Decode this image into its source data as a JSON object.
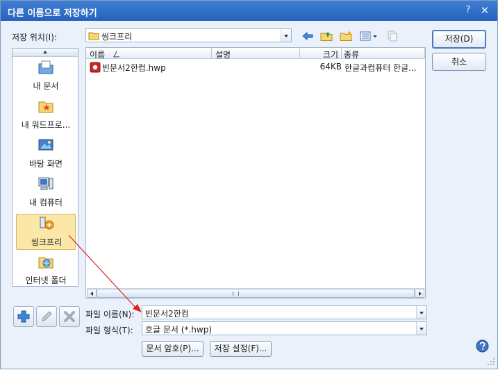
{
  "window": {
    "title": "다른 이름으로 저장하기",
    "help_glyph": "?",
    "close_glyph": "✕"
  },
  "location": {
    "label": "저장 위치(I):",
    "value": "씽크프리"
  },
  "places": [
    {
      "label": "내 문서",
      "icon": "my-documents-icon"
    },
    {
      "label": "내 워드프로...",
      "icon": "my-wordprocessor-icon"
    },
    {
      "label": "바탕 화면",
      "icon": "desktop-icon"
    },
    {
      "label": "내 컴퓨터",
      "icon": "my-computer-icon"
    },
    {
      "label": "씽크프리",
      "icon": "thinkfree-icon"
    },
    {
      "label": "인터넷 폴더",
      "icon": "internet-folder-icon"
    }
  ],
  "columns": {
    "name": "이름",
    "sort_glyph": "ㄥ",
    "description": "설명",
    "size": "크기",
    "type": "종류"
  },
  "files": [
    {
      "name": "빈문서2한컴.hwp",
      "size": "64KB",
      "type": "한글과컴퓨터 한글..."
    }
  ],
  "filename": {
    "label": "파일 이름(N):",
    "value": "빈문서2한컴"
  },
  "filetype": {
    "label": "파일 형식(T):",
    "value": "호글 문서 (*.hwp)"
  },
  "buttons": {
    "save": "저장(D)",
    "cancel": "취소",
    "password": "문서 암호(P)...",
    "settings": "저장 설정(F)..."
  },
  "colors": {
    "titlebar": "#2a66c3",
    "selected_place": "#fbe7a8",
    "annotation_arrow": "#e02020"
  }
}
